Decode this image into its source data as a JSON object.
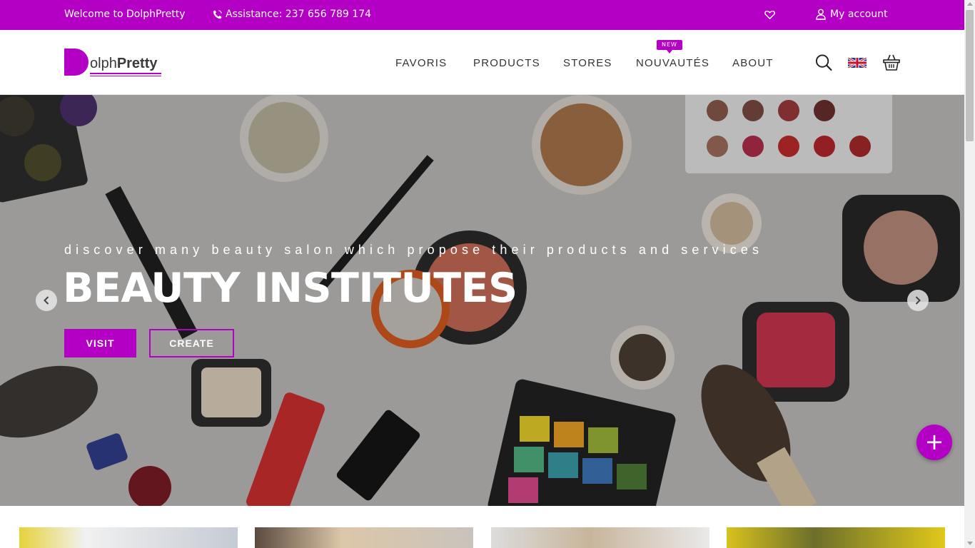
{
  "topbar": {
    "welcome": "Welcome to DolphPretty",
    "assistance": "Assistance: 237 656 789 174",
    "account": "My account"
  },
  "brand": {
    "logo_text_regular": "olph",
    "logo_text_bold": "Pretty",
    "accent_color": "#b300c4"
  },
  "nav": {
    "items": [
      {
        "label": "FAVORIS"
      },
      {
        "label": "PRODUCTS"
      },
      {
        "label": "STORES"
      },
      {
        "label": "NOUVAUTÉS",
        "badge": "NEW"
      },
      {
        "label": "ABOUT"
      }
    ]
  },
  "header_icons": [
    "search-icon",
    "flag-uk-icon",
    "basket-icon"
  ],
  "hero": {
    "subtitle": "discover many beauty salon which propose their products and services",
    "title": "BEAUTY INSTITUTES",
    "visit_label": "VISIT",
    "create_label": "CREATE",
    "fab_label": "+"
  }
}
